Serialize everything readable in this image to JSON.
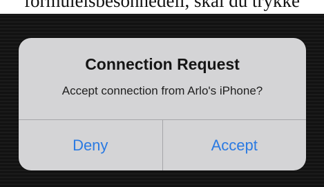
{
  "page": {
    "top_text": "formuleisbesonnedell, skal du trykke"
  },
  "alert": {
    "title": "Connection Request",
    "message": "Accept connection from Arlo's iPhone?",
    "buttons": {
      "deny": "Deny",
      "accept": "Accept"
    }
  },
  "colors": {
    "button_text": "#2a7ae2",
    "alert_background": "#d4d4d6",
    "backdrop": "#121212"
  }
}
